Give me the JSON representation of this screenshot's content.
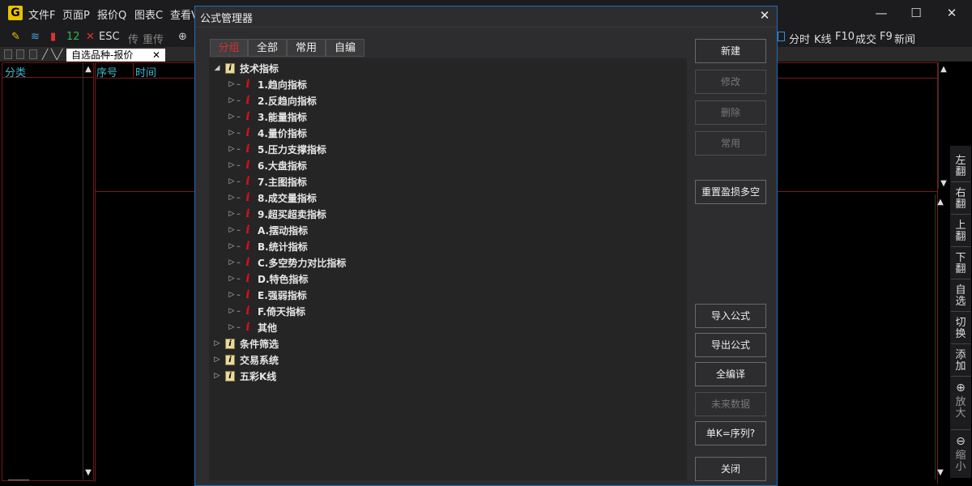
{
  "app": {
    "logo_letter": "G",
    "menus": [
      "文件F",
      "页面P",
      "报价Q",
      "图表C",
      "查看V"
    ]
  },
  "toolbar": {
    "num12": "12",
    "esc": "ESC",
    "rebroadcast": "重传",
    "right_items": [
      "分时",
      "K线",
      "F10",
      "成交",
      "F9",
      "新闻"
    ]
  },
  "tabstrip": {
    "active_tab": "自选品种-报价"
  },
  "left_panel": {
    "header": "分类"
  },
  "grid": {
    "col_seq": "序号",
    "col_time": "时间"
  },
  "right_bar": [
    "左翻",
    "右翻",
    "上翻",
    "下翻",
    "自选",
    "切换",
    "添加",
    "放大",
    "缩小"
  ],
  "dialog": {
    "title": "公式管理器",
    "tabs": [
      "分组",
      "全部",
      "常用",
      "自编"
    ],
    "active_tab": "分组",
    "tree": [
      {
        "label": "技术指标",
        "level": 0,
        "expanded": true,
        "icon": "folder-icon"
      },
      {
        "label": "1.趋向指标",
        "level": 1,
        "icon": "info-icon"
      },
      {
        "label": "2.反趋向指标",
        "level": 1,
        "icon": "info-icon"
      },
      {
        "label": "3.能量指标",
        "level": 1,
        "icon": "info-icon"
      },
      {
        "label": "4.量价指标",
        "level": 1,
        "icon": "info-icon"
      },
      {
        "label": "5.压力支撑指标",
        "level": 1,
        "icon": "info-icon"
      },
      {
        "label": "6.大盘指标",
        "level": 1,
        "icon": "info-icon"
      },
      {
        "label": "7.主图指标",
        "level": 1,
        "icon": "info-icon"
      },
      {
        "label": "8.成交量指标",
        "level": 1,
        "icon": "info-icon"
      },
      {
        "label": "9.超买超卖指标",
        "level": 1,
        "icon": "info-icon"
      },
      {
        "label": "A.摆动指标",
        "level": 1,
        "icon": "info-icon"
      },
      {
        "label": "B.统计指标",
        "level": 1,
        "icon": "info-icon"
      },
      {
        "label": "C.多空势力对比指标",
        "level": 1,
        "icon": "info-icon"
      },
      {
        "label": "D.特色指标",
        "level": 1,
        "icon": "info-icon"
      },
      {
        "label": "E.强弱指标",
        "level": 1,
        "icon": "info-icon"
      },
      {
        "label": "F.倚天指标",
        "level": 1,
        "icon": "info-icon"
      },
      {
        "label": "其他",
        "level": 1,
        "icon": "info-icon"
      },
      {
        "label": "条件筛选",
        "level": 0,
        "expanded": false,
        "icon": "folder-icon"
      },
      {
        "label": "交易系统",
        "level": 0,
        "expanded": false,
        "icon": "folder-icon"
      },
      {
        "label": "五彩K线",
        "level": 0,
        "expanded": false,
        "icon": "folder-icon"
      }
    ],
    "buttons_top": [
      {
        "label": "新建",
        "enabled": true
      },
      {
        "label": "修改",
        "enabled": false
      },
      {
        "label": "删除",
        "enabled": false
      },
      {
        "label": "常用",
        "enabled": false
      }
    ],
    "reset_button": "重置盈损多空",
    "buttons_bottom": [
      {
        "label": "导入公式",
        "enabled": true
      },
      {
        "label": "导出公式",
        "enabled": true
      },
      {
        "label": "全编译",
        "enabled": true
      },
      {
        "label": "未来数据",
        "enabled": false
      },
      {
        "label": "单K=序列?",
        "enabled": true
      },
      {
        "label": "关闭",
        "enabled": true
      }
    ]
  },
  "colors": {
    "accent_red": "#d0312d",
    "header_cyan": "#39b7c7",
    "dialog_border": "#1f6fb5"
  }
}
